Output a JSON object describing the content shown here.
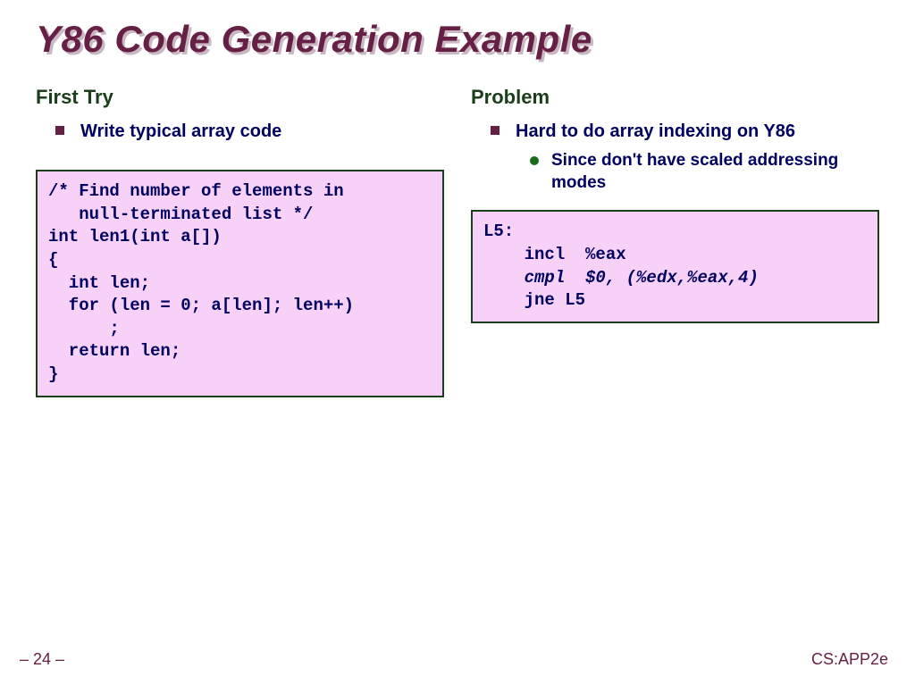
{
  "title": "Y86 Code Generation Example",
  "left": {
    "subtitle": "First Try",
    "bullet": "Write typical array code",
    "code": "/* Find number of elements in\n   null-terminated list */\nint len1(int a[])\n{\n  int len;\n  for (len = 0; a[len]; len++)\n      ;\n  return len;\n}"
  },
  "right": {
    "subtitle": "Problem",
    "bullet": "Hard to do array indexing on Y86",
    "subbullet": "Since don't have scaled addressing modes",
    "code_line1": "L5:",
    "code_line2": "    incl  %eax",
    "code_line3": "    cmpl  $0, (%edx,%eax,4)",
    "code_line4": "    jne L5"
  },
  "footer": {
    "page": "– 24 –",
    "source": "CS:APP2e"
  }
}
